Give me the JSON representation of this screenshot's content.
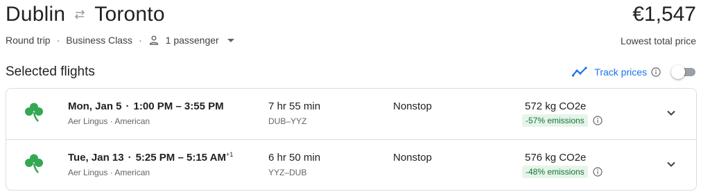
{
  "header": {
    "origin": "Dublin",
    "destination": "Toronto",
    "swap_icon": "swap-arrows-icon",
    "price": "€1,547",
    "price_caption": "Lowest total price"
  },
  "trip_meta": {
    "trip_type": "Round trip",
    "cabin": "Business Class",
    "passengers": "1 passenger",
    "separator": "·"
  },
  "section": {
    "title": "Selected flights",
    "track_label": "Track prices",
    "track_enabled": false
  },
  "colors": {
    "accent": "#1a73e8",
    "aer_lingus_green": "#34a853",
    "emissions_bg": "#e6f4ea",
    "emissions_text": "#137333",
    "border": "#dadce0"
  },
  "flights": [
    {
      "date": "Mon, Jan 5",
      "depart": "1:00 PM",
      "arrive": "3:55 PM",
      "day_offset": "",
      "airlines": "Aer Lingus · American",
      "duration": "7 hr 55 min",
      "route": "DUB–YYZ",
      "stops": "Nonstop",
      "co2": "572 kg CO2e",
      "emissions": "-57% emissions"
    },
    {
      "date": "Tue, Jan 13",
      "depart": "5:25 PM",
      "arrive": "5:15 AM",
      "day_offset": "+1",
      "airlines": "Aer Lingus · American",
      "duration": "6 hr 50 min",
      "route": "YYZ–DUB",
      "stops": "Nonstop",
      "co2": "576 kg CO2e",
      "emissions": "-48% emissions"
    }
  ]
}
